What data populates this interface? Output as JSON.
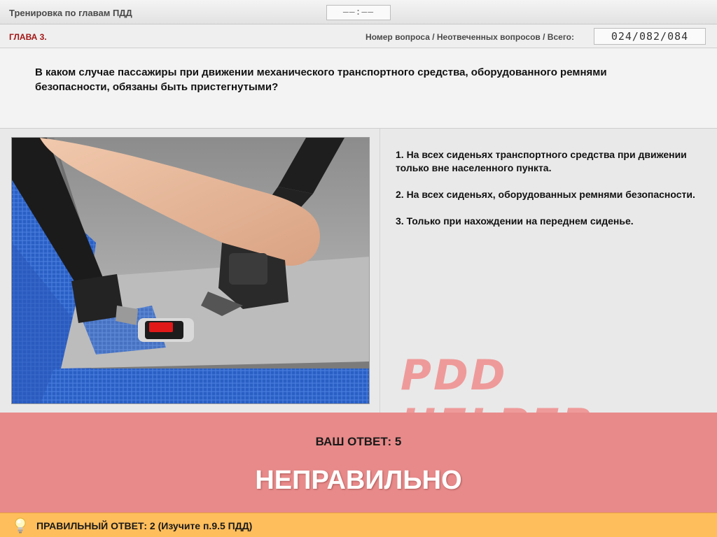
{
  "header": {
    "title": "Тренировка по главам ПДД",
    "timer": "––:––"
  },
  "chapter_bar": {
    "chapter": "ГЛАВА 3.",
    "counter_label": "Номер вопроса / Неотвеченных вопросов / Всего:",
    "counter_value": "024/082/084"
  },
  "question": {
    "text": "В каком случае пассажиры при движении механического транспортного средства, оборудованного ремнями безопасности, обязаны быть пристегнутыми?"
  },
  "image": {
    "icon": "seat-belt-photo"
  },
  "answers": [
    {
      "text": "1.  На всех сиденьях транспортного средства при движении только вне населенного пункта."
    },
    {
      "text": "2.  На всех сиденьях, оборудованных ремнями безопасности."
    },
    {
      "text": "3.  Только при нахождении на переднем сиденье."
    }
  ],
  "brand": "PDD HELPER",
  "result": {
    "your_answer": "ВАШ  ОТВЕТ:   5",
    "verdict": "НЕПРАВИЛЬНО",
    "verdict_color": "#e88a8a"
  },
  "footer": {
    "icon": "lightbulb-icon",
    "correct_answer": "ПРАВИЛЬНЫЙ ОТВЕТ:   2   (Изучите п.9.5 ПДД)",
    "color": "#ffbe5c"
  }
}
